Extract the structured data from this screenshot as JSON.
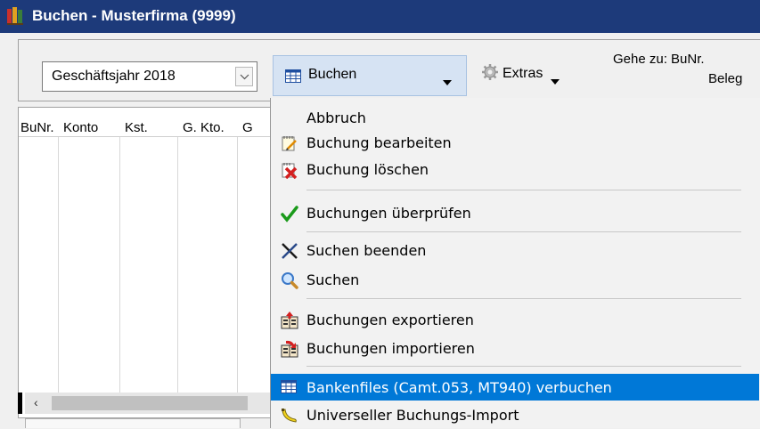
{
  "window": {
    "title": "Buchen - Musterfirma (9999)",
    "icon": "books-app-icon"
  },
  "toolbar": {
    "year_select": {
      "value": "Geschäftsjahr 2018"
    },
    "buchen_button": {
      "label": "Buchen",
      "icon": "table-icon"
    },
    "extras_button": {
      "label": "Extras",
      "icon": "gear-icon"
    },
    "gehe_zu_label": "Gehe zu: BuNr.",
    "beleg_label": "Beleg"
  },
  "grid": {
    "columns": [
      "BuNr.",
      "Konto",
      "Kst.",
      "G. Kto.",
      "G"
    ]
  },
  "menu": {
    "items": [
      {
        "label": "Abbruch",
        "icon": ""
      },
      {
        "label": "Buchung bearbeiten",
        "icon": "notepad-edit-icon"
      },
      {
        "label": "Buchung löschen",
        "icon": "delete-x-icon"
      },
      {
        "label": "Buchungen überprüfen",
        "icon": "checkmark-icon"
      },
      {
        "label": "Suchen beenden",
        "icon": "cross-icon"
      },
      {
        "label": "Suchen",
        "icon": "magnifier-icon"
      },
      {
        "label": "Buchungen exportieren",
        "icon": "export-icon"
      },
      {
        "label": "Buchungen importieren",
        "icon": "import-icon"
      },
      {
        "label": "Bankenfiles (Camt.053, MT940) verbuchen",
        "icon": "table-icon"
      },
      {
        "label": "Universeller Buchungs-Import",
        "icon": "banana-icon"
      }
    ],
    "highlighted_index": 8
  },
  "colors": {
    "title_bar": "#1d3a7a",
    "highlight": "#0078d7",
    "button_active": "#d6e3f3"
  }
}
